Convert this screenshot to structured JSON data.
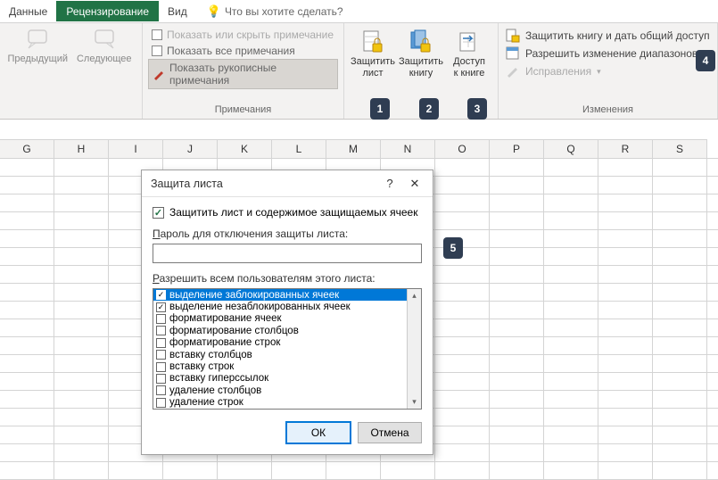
{
  "tabs": {
    "data": "Данные",
    "review": "Рецензирование",
    "view": "Вид"
  },
  "tell_me": "Что вы хотите сделать?",
  "nav": {
    "prev": "Предыдущий",
    "next": "Следующее",
    "group_label": ""
  },
  "comments": {
    "toggle": "Показать или скрыть примечание",
    "show_all": "Показать все примечания",
    "ink": "Показать рукописные примечания",
    "group_label": "Примечания"
  },
  "protect": {
    "sheet_l1": "Защитить",
    "sheet_l2": "лист",
    "book_l1": "Защитить",
    "book_l2": "книгу",
    "share_l1": "Доступ",
    "share_l2": "к книге"
  },
  "changes": {
    "share_protect": "Защитить книгу и дать общий доступ",
    "allow_ranges": "Разрешить изменение диапазонов",
    "track": "Исправления",
    "group_label": "Изменения"
  },
  "columns": [
    "G",
    "H",
    "I",
    "J",
    "K",
    "L",
    "M",
    "N",
    "O",
    "P",
    "Q",
    "R",
    "S"
  ],
  "badges": {
    "b1": "1",
    "b2": "2",
    "b3": "3",
    "b4": "4",
    "b5": "5"
  },
  "dialog": {
    "title": "Защита листа",
    "help": "?",
    "close": "✕",
    "protect_chk_prefix": "Защитить лист и ",
    "protect_chk_ul": "с",
    "protect_chk_suffix": "одержимое защищаемых ячеек",
    "pw_prefix": "",
    "pw_ul": "П",
    "pw_suffix": "ароль для отключения защиты листа:",
    "pw_value": "",
    "perm_prefix": "",
    "perm_ul": "Р",
    "perm_suffix": "азрешить всем пользователям этого листа:",
    "perms": [
      {
        "label": "выделение заблокированных ячеек",
        "checked": true
      },
      {
        "label": "выделение незаблокированных ячеек",
        "checked": true
      },
      {
        "label": "форматирование ячеек",
        "checked": false
      },
      {
        "label": "форматирование столбцов",
        "checked": false
      },
      {
        "label": "форматирование строк",
        "checked": false
      },
      {
        "label": "вставку столбцов",
        "checked": false
      },
      {
        "label": "вставку строк",
        "checked": false
      },
      {
        "label": "вставку гиперссылок",
        "checked": false
      },
      {
        "label": "удаление столбцов",
        "checked": false
      },
      {
        "label": "удаление строк",
        "checked": false
      }
    ],
    "ok": "ОК",
    "cancel": "Отмена"
  }
}
